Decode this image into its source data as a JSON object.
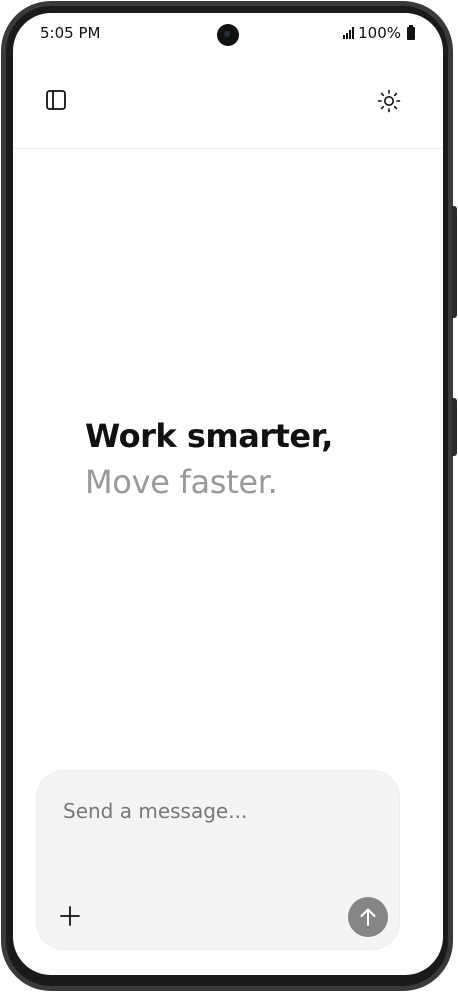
{
  "status_bar": {
    "time": "5:05 PM",
    "battery_text": "100%"
  },
  "header": {
    "sidebar_icon": "sidebar-toggle-icon",
    "theme_icon": "sun-icon"
  },
  "hero": {
    "title": "Work smarter,",
    "subtitle": "Move faster."
  },
  "composer": {
    "placeholder": "Send a message...",
    "value": "",
    "attach_icon": "plus-icon",
    "send_icon": "arrow-up-icon"
  },
  "colors": {
    "accent_send": "#858585",
    "subtitle": "#9a9a9a",
    "composer_bg": "#f4f4f4"
  }
}
